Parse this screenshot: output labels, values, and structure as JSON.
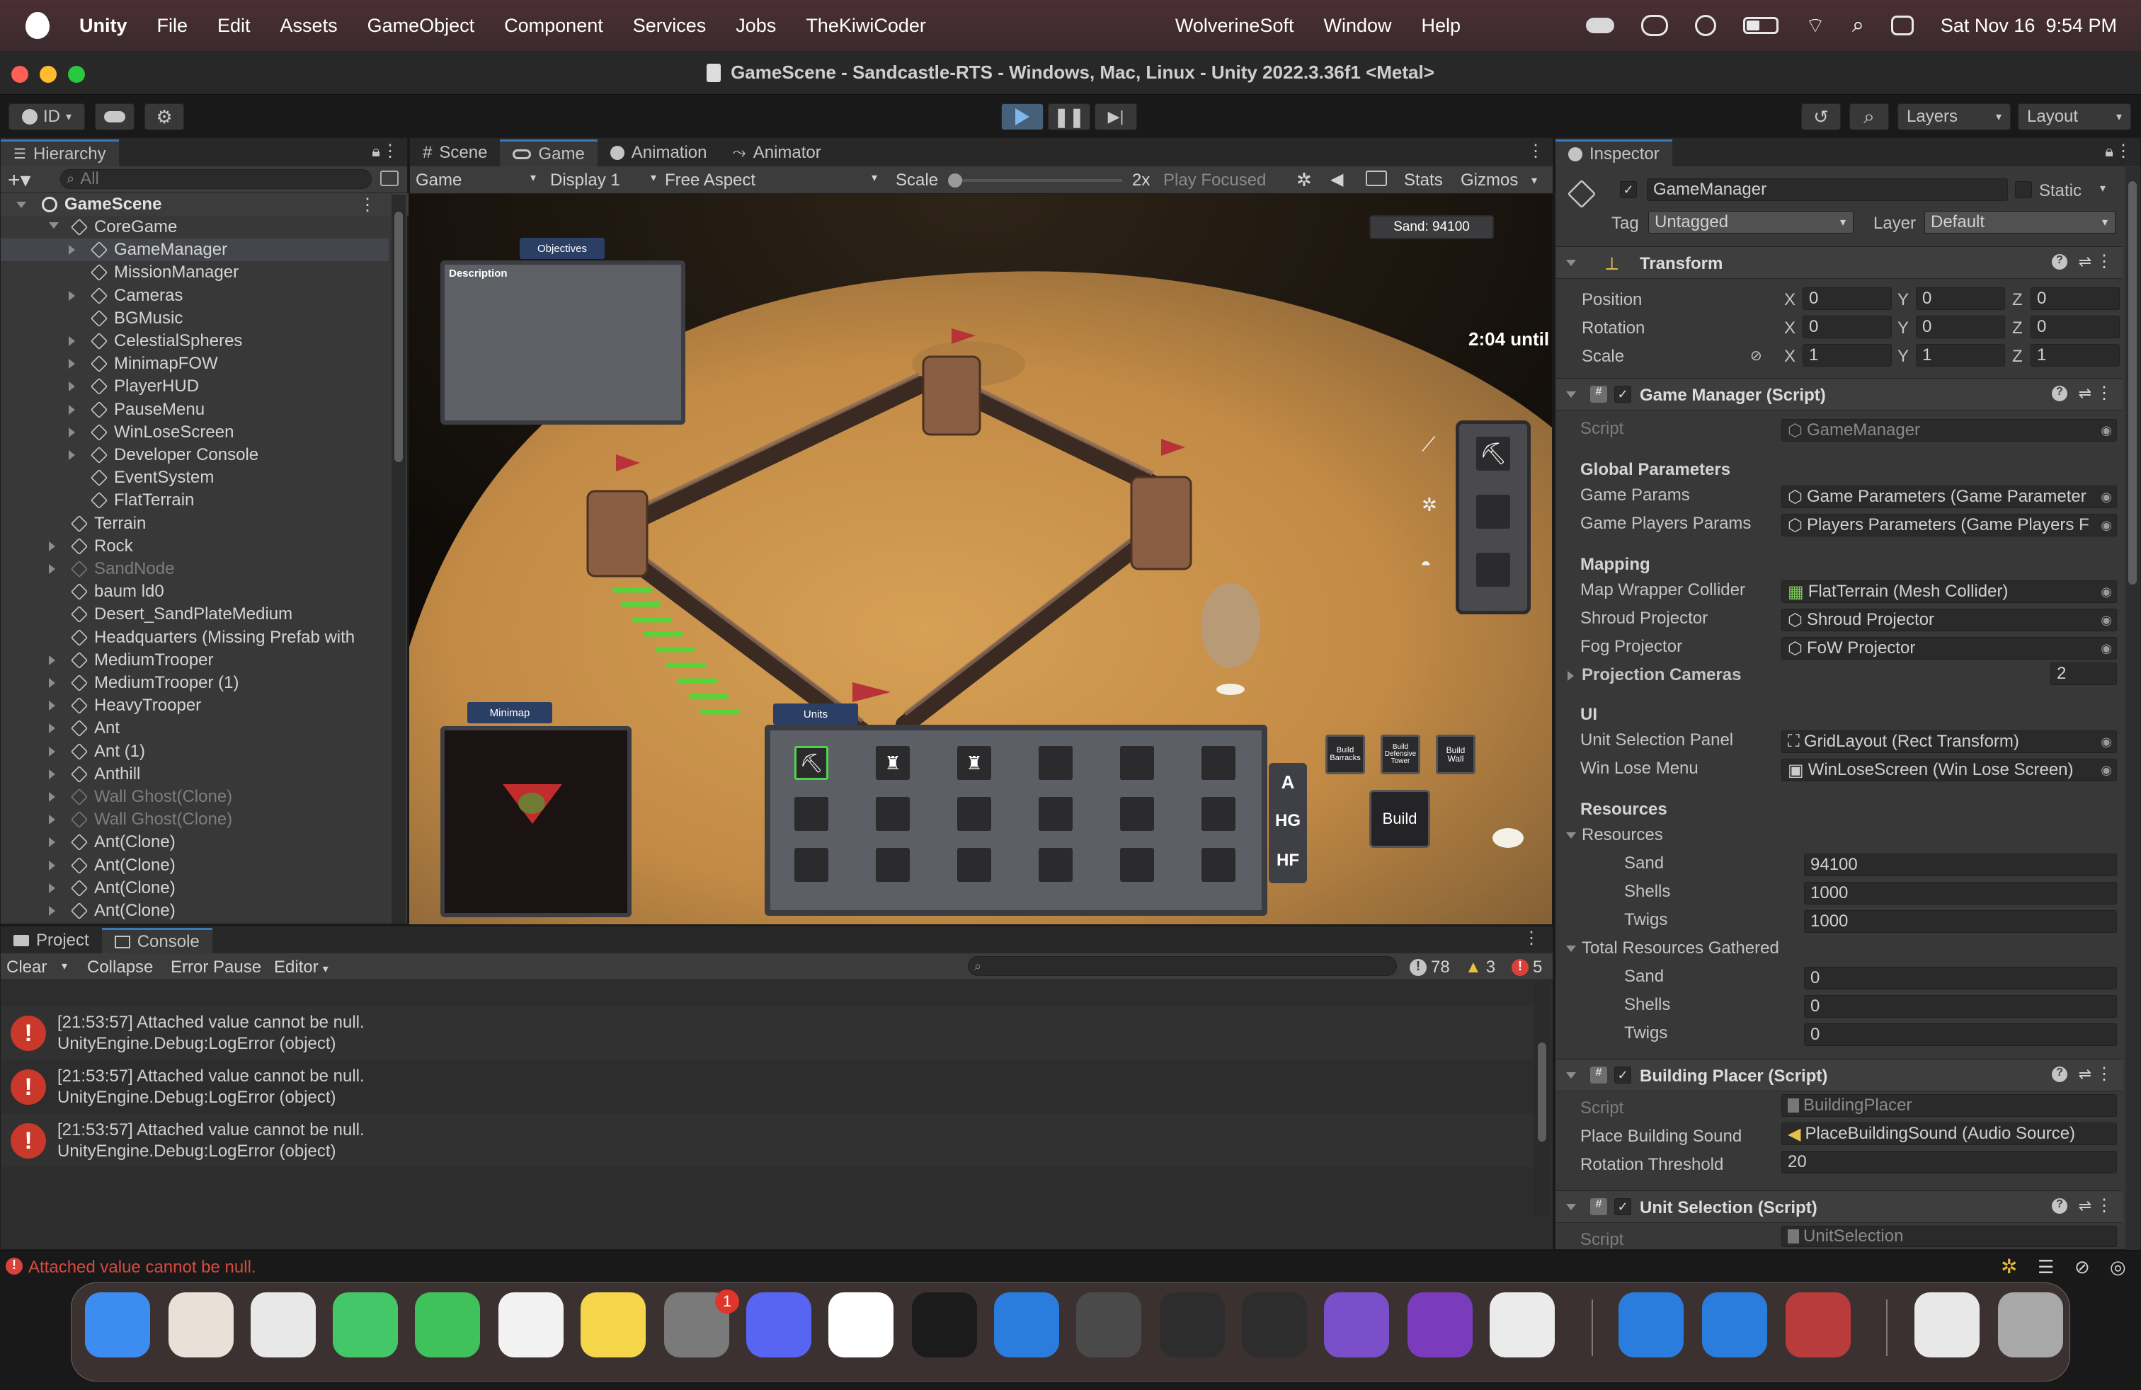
{
  "menubar": {
    "app": "Unity",
    "items": [
      "File",
      "Edit",
      "Assets",
      "GameObject",
      "Component",
      "Services",
      "Jobs",
      "TheKiwiCoder"
    ],
    "right_items": [
      "WolverineSoft",
      "Window",
      "Help"
    ],
    "clock": "Sat Nov 16  9:54 PM"
  },
  "window": {
    "title": "GameScene - Sandcastle-RTS - Windows, Mac, Linux - Unity 2022.3.36f1 <Metal>"
  },
  "toolbar": {
    "account": "ID",
    "layers": "Layers",
    "layout": "Layout"
  },
  "hierarchy": {
    "tab": "Hierarchy",
    "search_placeholder": "All",
    "scene": "GameScene",
    "items": [
      {
        "label": "CoreGame",
        "depth": 1,
        "expand": "open",
        "dim": false
      },
      {
        "label": "GameManager",
        "depth": 2,
        "expand": "closed",
        "dim": false
      },
      {
        "label": "MissionManager",
        "depth": 2,
        "expand": "none",
        "dim": false
      },
      {
        "label": "Cameras",
        "depth": 2,
        "expand": "closed",
        "dim": false
      },
      {
        "label": "BGMusic",
        "depth": 2,
        "expand": "none",
        "dim": false
      },
      {
        "label": "CelestialSpheres",
        "depth": 2,
        "expand": "closed",
        "dim": false
      },
      {
        "label": "MinimapFOW",
        "depth": 2,
        "expand": "closed",
        "dim": false
      },
      {
        "label": "PlayerHUD",
        "depth": 2,
        "expand": "closed",
        "dim": false
      },
      {
        "label": "PauseMenu",
        "depth": 2,
        "expand": "closed",
        "dim": false
      },
      {
        "label": "WinLoseScreen",
        "depth": 2,
        "expand": "closed",
        "dim": false
      },
      {
        "label": "Developer Console",
        "depth": 2,
        "expand": "closed",
        "dim": false
      },
      {
        "label": "EventSystem",
        "depth": 2,
        "expand": "none",
        "dim": false
      },
      {
        "label": "FlatTerrain",
        "depth": 2,
        "expand": "none",
        "dim": false
      },
      {
        "label": "Terrain",
        "depth": 1,
        "expand": "none",
        "dim": false
      },
      {
        "label": "Rock",
        "depth": 1,
        "expand": "closed",
        "dim": false
      },
      {
        "label": "SandNode",
        "depth": 1,
        "expand": "closed",
        "dim": true
      },
      {
        "label": "baum ld0",
        "depth": 1,
        "expand": "none",
        "dim": false
      },
      {
        "label": "Desert_SandPlateMedium",
        "depth": 1,
        "expand": "none",
        "dim": false
      },
      {
        "label": "Headquarters (Missing Prefab with",
        "depth": 1,
        "expand": "none",
        "dim": false
      },
      {
        "label": "MediumTrooper",
        "depth": 1,
        "expand": "closed",
        "dim": false
      },
      {
        "label": "MediumTrooper (1)",
        "depth": 1,
        "expand": "closed",
        "dim": false
      },
      {
        "label": "HeavyTrooper",
        "depth": 1,
        "expand": "closed",
        "dim": false
      },
      {
        "label": "Ant",
        "depth": 1,
        "expand": "closed",
        "dim": false
      },
      {
        "label": "Ant (1)",
        "depth": 1,
        "expand": "closed",
        "dim": false
      },
      {
        "label": "Anthill",
        "depth": 1,
        "expand": "closed",
        "dim": false
      },
      {
        "label": "Wall Ghost(Clone)",
        "depth": 1,
        "expand": "closed",
        "dim": true
      },
      {
        "label": "Wall Ghost(Clone)",
        "depth": 1,
        "expand": "closed",
        "dim": true
      },
      {
        "label": "Ant(Clone)",
        "depth": 1,
        "expand": "closed",
        "dim": false
      },
      {
        "label": "Ant(Clone)",
        "depth": 1,
        "expand": "closed",
        "dim": false
      },
      {
        "label": "Ant(Clone)",
        "depth": 1,
        "expand": "closed",
        "dim": false
      },
      {
        "label": "Ant(Clone)",
        "depth": 1,
        "expand": "closed",
        "dim": false
      }
    ]
  },
  "center_tabs": [
    "Scene",
    "Game",
    "Animation",
    "Animator"
  ],
  "game_toolbar": {
    "display_mode": "Game",
    "display": "Display 1",
    "aspect": "Free Aspect",
    "scale_label": "Scale",
    "scale_value": "2x",
    "play_mode": "Play Focused",
    "stats": "Stats",
    "gizmos": "Gizmos"
  },
  "game_hud": {
    "sand": "Sand: 94100",
    "objectives_tab": "Objectives",
    "description": "Description",
    "timer": "2:04 until",
    "minimap_tab": "Minimap",
    "units_tab": "Units",
    "side_buttons": [
      "A",
      "HG",
      "HF"
    ],
    "build_buttons": [
      "Build Barracks",
      "Build Defensive Tower",
      "Build Wall"
    ],
    "build_main": "Build"
  },
  "inspector": {
    "tab": "Inspector",
    "object_name": "GameManager",
    "static_label": "Static",
    "tag_label": "Tag",
    "tag": "Untagged",
    "layer_label": "Layer",
    "layer": "Default",
    "transform": {
      "title": "Transform",
      "rows": [
        {
          "label": "Position",
          "x": "0",
          "y": "0",
          "z": "0"
        },
        {
          "label": "Rotation",
          "x": "0",
          "y": "0",
          "z": "0"
        },
        {
          "label": "Scale",
          "x": "1",
          "y": "1",
          "z": "1"
        }
      ]
    },
    "game_manager": {
      "title": "Game Manager (Script)",
      "script_label": "Script",
      "script": "GameManager",
      "global_header": "Global Parameters",
      "game_params_label": "Game Params",
      "game_params": "Game Parameters (Game Parameter",
      "players_params_label": "Game Players Params",
      "players_params": "Players Parameters (Game Players F",
      "mapping_header": "Mapping",
      "map_wrapper_label": "Map Wrapper Collider",
      "map_wrapper": "FlatTerrain (Mesh Collider)",
      "shroud_label": "Shroud Projector",
      "shroud": "Shroud Projector",
      "fog_label": "Fog Projector",
      "fog": "FoW Projector",
      "proj_cams_label": "Projection Cameras",
      "proj_cams": "2",
      "ui_header": "UI",
      "unit_panel_label": "Unit Selection Panel",
      "unit_panel": "GridLayout (Rect Transform)",
      "win_lose_label": "Win Lose Menu",
      "win_lose": "WinLoseScreen (Win Lose Screen)",
      "resources_header": "Resources",
      "resources_fold": "Resources",
      "sand_label": "Sand",
      "sand": "94100",
      "shells_label": "Shells",
      "shells": "1000",
      "twigs_label": "Twigs",
      "twigs": "1000",
      "gathered_fold": "Total Resources Gathered",
      "g_sand": "0",
      "g_shells": "0",
      "g_twigs": "0"
    },
    "building_placer": {
      "title": "Building Placer (Script)",
      "script_label": "Script",
      "script": "BuildingPlacer",
      "sound_label": "Place Building Sound",
      "sound": "PlaceBuildingSound (Audio Source)",
      "rot_label": "Rotation Threshold",
      "rot": "20"
    },
    "unit_selection": {
      "title": "Unit Selection (Script)",
      "script_label": "Script",
      "script": "UnitSelection"
    }
  },
  "bottom": {
    "tabs": [
      "Project",
      "Console"
    ],
    "clear": "Clear",
    "collapse": "Collapse",
    "error_pause": "Error Pause",
    "editor": "Editor",
    "count_info": "78",
    "count_warn": "3",
    "count_err": "5",
    "logs": [
      {
        "line1": "[21:53:57] Attached value cannot be null.",
        "line2": "UnityEngine.Debug:LogError (object)"
      },
      {
        "line1": "[21:53:57] Attached value cannot be null.",
        "line2": "UnityEngine.Debug:LogError (object)"
      },
      {
        "line1": "[21:53:57] Attached value cannot be null.",
        "line2": "UnityEngine.Debug:LogError (object)"
      }
    ],
    "status": "Attached value cannot be null."
  },
  "dock": {
    "apps": [
      "Finder",
      "Launchpad",
      "Chrome",
      "Messages",
      "FaceTime",
      "Reminders",
      "Notes",
      "System Settings",
      "Discord",
      "Slack",
      "Terminal",
      "VS Code",
      "Unity Hub",
      "Unity",
      "Unity",
      "Visual Studio",
      "OneNote",
      "Safari",
      "VS Code",
      "VS Code",
      "Dictionary",
      "Documents",
      "Trash"
    ],
    "settings_badge": "1"
  },
  "colors": {
    "accent": "#3a79bb",
    "error": "#c9382a",
    "sand": "#d9a35a",
    "selection": "#44464b"
  }
}
